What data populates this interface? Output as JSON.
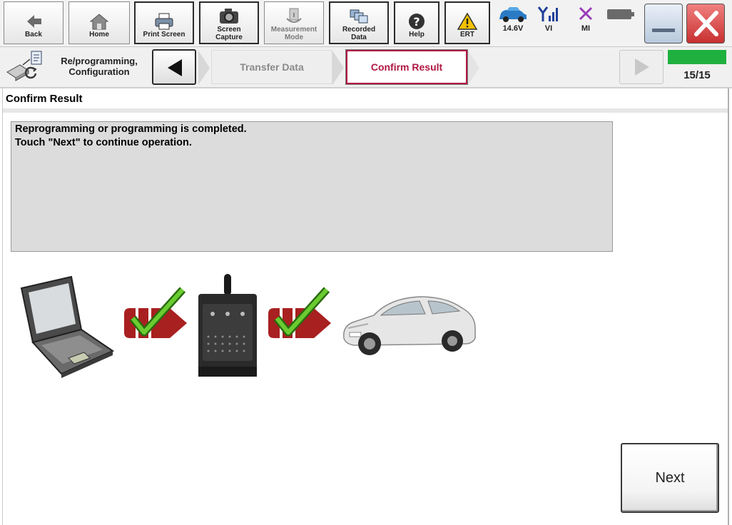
{
  "toolbar": {
    "back_label": "Back",
    "home_label": "Home",
    "print_label": "Print Screen",
    "capture_line1": "Screen",
    "capture_line2": "Capture",
    "measure_line1": "Measurement",
    "measure_line2": "Mode",
    "recorded_line1": "Recorded",
    "recorded_line2": "Data",
    "help_label": "Help",
    "ert_label": "ERT"
  },
  "status": {
    "battery_voltage": "14.6V",
    "vi_label": "VI",
    "mi_label": "MI"
  },
  "nav": {
    "section_line1": "Re/programming,",
    "section_line2": "Configuration",
    "step_prev": "Transfer Data",
    "step_current": "Confirm Result",
    "progress_text": "15/15",
    "progress_fraction": 1.0
  },
  "main": {
    "page_title": "Confirm Result",
    "message_line1": "Reprogramming or programming is completed.",
    "message_line2": "Touch \"Next\" to continue operation.",
    "next_label": "Next"
  },
  "icons": {
    "back": "arrow-left-icon",
    "home": "house-icon",
    "print": "printer-icon",
    "capture": "camera-icon",
    "measure": "gauge-icon",
    "recorded": "folders-icon",
    "help": "question-icon",
    "ert": "warning-triangle-icon",
    "car_status": "car-icon",
    "vi": "signal-icon",
    "mi": "cross-icon",
    "battery": "battery-icon"
  },
  "colors": {
    "accent_current_step": "#b01842",
    "progress_green": "#20b040",
    "close_red": "#d24040",
    "check_green": "#3aa020",
    "transfer_arrow": "#a82020"
  }
}
